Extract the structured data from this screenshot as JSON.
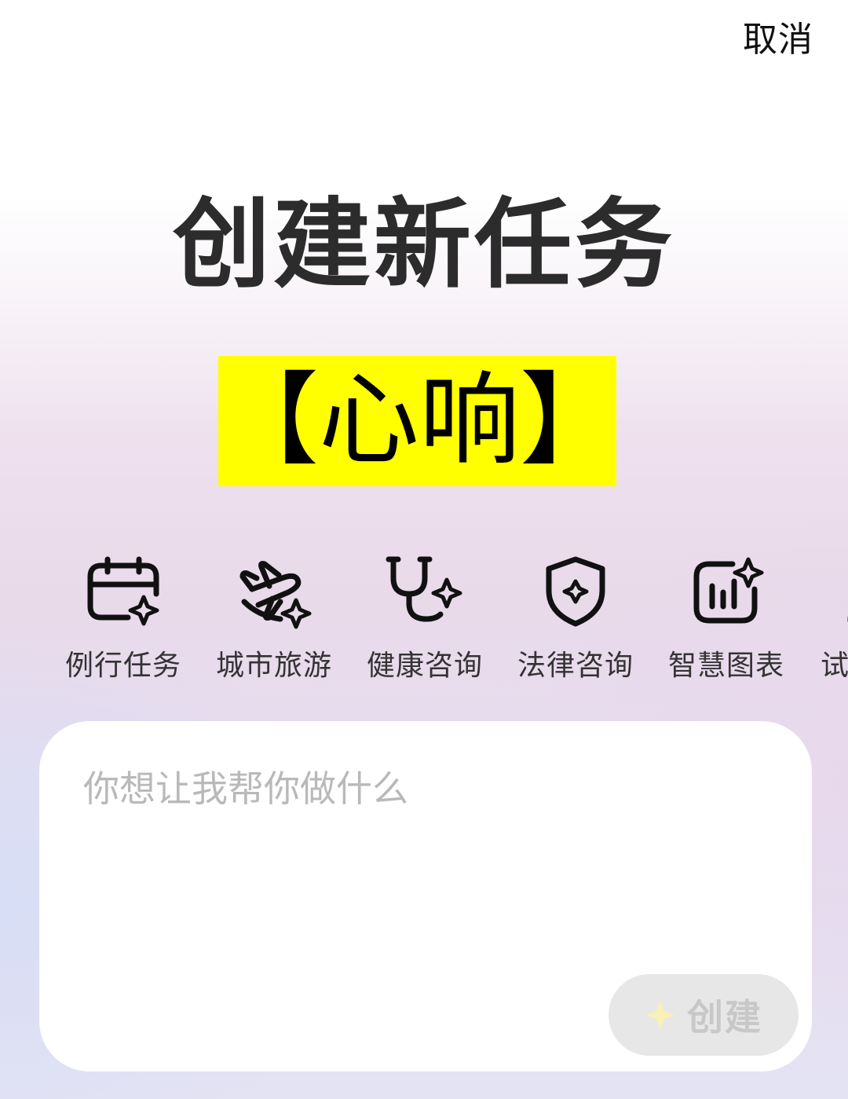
{
  "header": {
    "cancel_label": "取消"
  },
  "title": "创建新任务",
  "highlight_label": "【心响】",
  "categories": [
    {
      "label": "例行任务",
      "icon": "calendar-sparkle-icon"
    },
    {
      "label": "城市旅游",
      "icon": "plane-sparkle-icon"
    },
    {
      "label": "健康咨询",
      "icon": "stethoscope-sparkle-icon"
    },
    {
      "label": "法律咨询",
      "icon": "shield-sparkle-icon"
    },
    {
      "label": "智慧图表",
      "icon": "chart-sparkle-icon"
    },
    {
      "label": "试",
      "icon": "person-icon"
    }
  ],
  "input": {
    "placeholder": "你想让我帮你做什么",
    "value": ""
  },
  "create_button": {
    "label": "创建",
    "icon": "sparkle-icon",
    "star_color": "#fbf0b4"
  },
  "colors": {
    "highlight": "#ffff00",
    "title": "#2c2c2c",
    "icon_stroke": "#111111"
  }
}
